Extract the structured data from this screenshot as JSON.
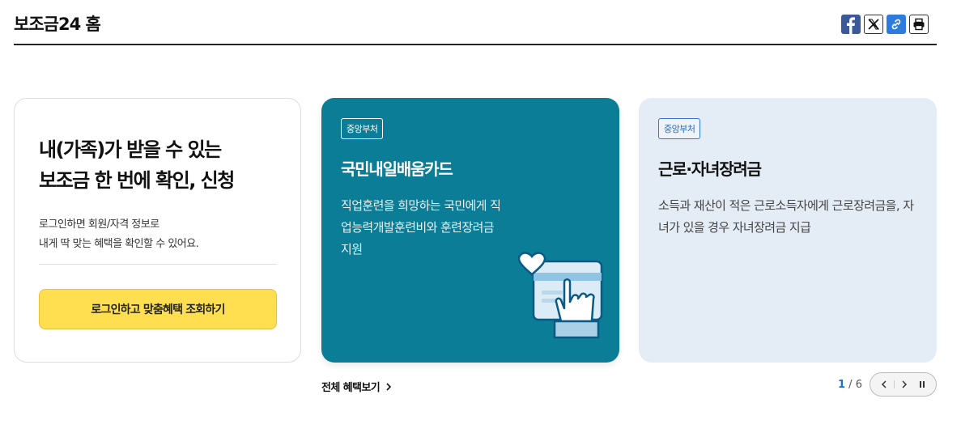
{
  "header": {
    "title": "보조금24 홈",
    "share": [
      {
        "name": "facebook-icon"
      },
      {
        "name": "x-icon"
      },
      {
        "name": "link-icon"
      },
      {
        "name": "print-icon"
      }
    ]
  },
  "login_card": {
    "heading_line1": "내(가족)가 받을 수 있는",
    "heading_line2": "보조금 한 번에 확인, 신청",
    "desc_line1": "로그인하면 회원/자격 정보로",
    "desc_line2": "내게 딱 맞는 혜택을 확인할 수 있어요.",
    "button": "로그인하고 맞춤혜택 조회하기"
  },
  "benefits": [
    {
      "badge": "중앙부처",
      "title": "국민내일배움카드",
      "desc": "직업훈련을 희망하는 국민에게 직업능력개발훈련비와 훈련장려금 지원",
      "color": "#0c7d96",
      "icon": "card-touch-heart-illustration"
    },
    {
      "badge": "중앙부처",
      "title": "근로·자녀장려금",
      "desc": "소득과 재산이 적은 근로소득자에게 근로장려금을, 자녀가 있을 경우 자녀장려금 지급",
      "color": "#e4ecf6"
    }
  ],
  "footer": {
    "all_link": "전체 혜택보기",
    "page_current": "1",
    "page_sep": " / ",
    "page_total": "6"
  }
}
